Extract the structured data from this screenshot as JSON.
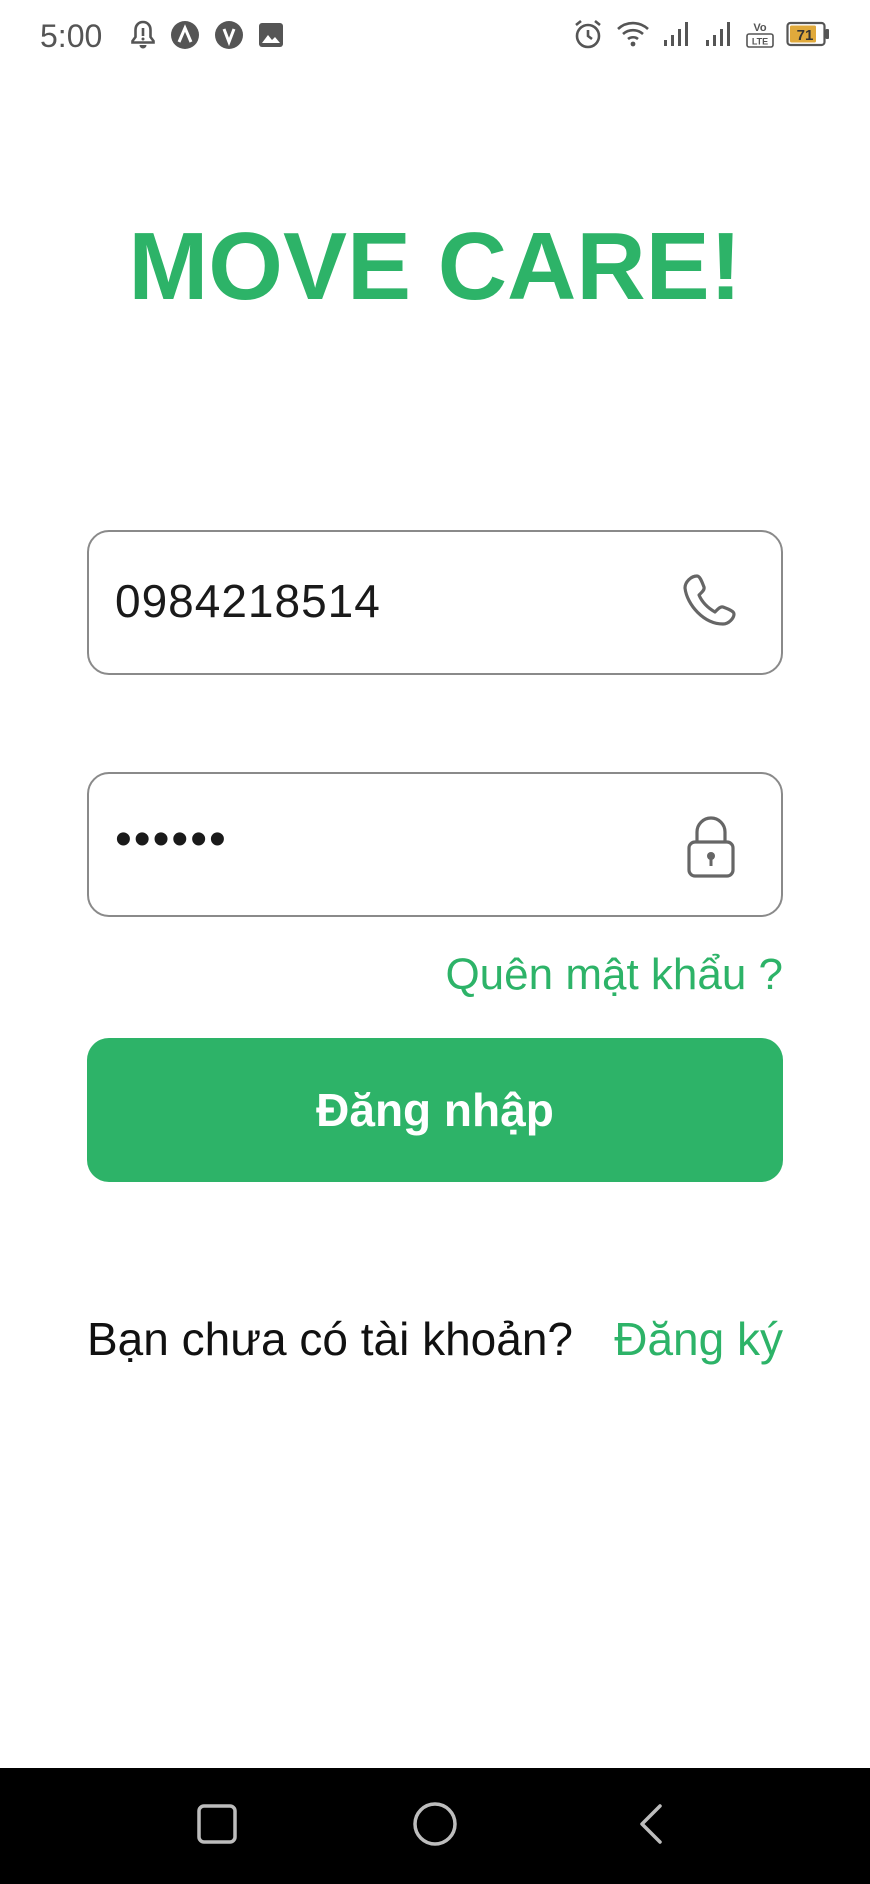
{
  "status_bar": {
    "time": "5:00",
    "left_icons": [
      "notification-bell-icon",
      "app-icon-a",
      "app-icon-v",
      "image-icon"
    ],
    "right_icons": [
      "alarm-icon",
      "wifi-icon",
      "signal-icon-1",
      "signal-icon-2",
      "volte-icon",
      "battery-icon"
    ],
    "volte_label": "Vo\nLTE",
    "battery_level": "71"
  },
  "app": {
    "title": "MOVE CARE!"
  },
  "form": {
    "phone_value": "0984218514",
    "password_value": "••••••",
    "forgot_label": "Quên mật khẩu ?",
    "login_label": "Đăng nhập",
    "signup_prompt": "Bạn chưa có tài khoản?",
    "signup_label": "Đăng ký"
  },
  "nav": {
    "buttons": [
      "recents",
      "home",
      "back"
    ]
  },
  "colors": {
    "accent": "#2db368",
    "field_border": "#8a8a8a",
    "nav_bg": "#000000"
  }
}
